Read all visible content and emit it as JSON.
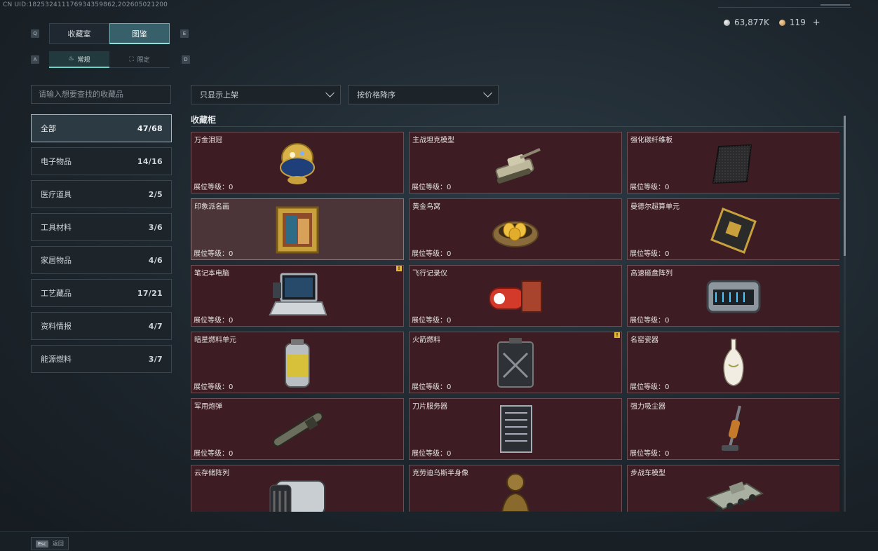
{
  "uid": "CN UID:182532411176934359862,202605021200",
  "currency": {
    "silver": "63,877K",
    "gold": "119",
    "add": "+"
  },
  "key_hints": {
    "tab_left": "Q",
    "tab_right": "E",
    "sub_left": "A",
    "sub_right": "D"
  },
  "tabs": [
    {
      "label": "收藏室",
      "active": false
    },
    {
      "label": "图鉴",
      "active": true
    }
  ],
  "subtabs": [
    {
      "label": "常规",
      "active": true
    },
    {
      "label": "限定",
      "active": false
    }
  ],
  "search": {
    "placeholder": "请输入想要查找的收藏品"
  },
  "categories": [
    {
      "label": "全部",
      "count": "47/68",
      "active": true
    },
    {
      "label": "电子物品",
      "count": "14/16"
    },
    {
      "label": "医疗道具",
      "count": "2/5"
    },
    {
      "label": "工具材料",
      "count": "3/6"
    },
    {
      "label": "家居物品",
      "count": "4/6"
    },
    {
      "label": "工艺藏品",
      "count": "17/21"
    },
    {
      "label": "资料情报",
      "count": "4/7"
    },
    {
      "label": "能源燃料",
      "count": "3/7"
    }
  ],
  "filters": {
    "show": "只显示上架",
    "sort": "按价格降序"
  },
  "section_title": "收藏柜",
  "level_label": "展位等级：0",
  "badge_text": "!",
  "items": [
    {
      "name": "万金泪冠",
      "icon": "jeweled-egg-icon"
    },
    {
      "name": "主战坦克模型",
      "icon": "tank-model-icon"
    },
    {
      "name": "强化碳纤维板",
      "icon": "carbon-plate-icon"
    },
    {
      "name": "印象派名画",
      "icon": "framed-painting-icon"
    },
    {
      "name": "黄金鸟窝",
      "icon": "golden-nest-icon"
    },
    {
      "name": "曼德尔超算单元",
      "icon": "supercomputer-unit-icon"
    },
    {
      "name": "笔记本电脑",
      "icon": "laptop-icon",
      "badge": true
    },
    {
      "name": "飞行记录仪",
      "icon": "flight-recorder-icon"
    },
    {
      "name": "高速磁盘阵列",
      "icon": "disk-array-icon"
    },
    {
      "name": "暗星燃料单元",
      "icon": "fuel-canister-icon"
    },
    {
      "name": "火箭燃料",
      "icon": "rocket-fuel-icon",
      "badge": true
    },
    {
      "name": "名窑瓷器",
      "icon": "porcelain-vase-icon"
    },
    {
      "name": "军用炮弹",
      "icon": "artillery-shell-icon"
    },
    {
      "name": "刀片服务器",
      "icon": "blade-server-icon"
    },
    {
      "name": "强力吸尘器",
      "icon": "vacuum-cleaner-icon"
    },
    {
      "name": "云存储阵列",
      "icon": "cloud-storage-icon"
    },
    {
      "name": "克劳迪乌斯半身像",
      "icon": "bust-statue-icon"
    },
    {
      "name": "步战车模型",
      "icon": "ifv-model-icon"
    }
  ],
  "footer": {
    "esc_key": "Esc",
    "esc_label": "返回"
  }
}
